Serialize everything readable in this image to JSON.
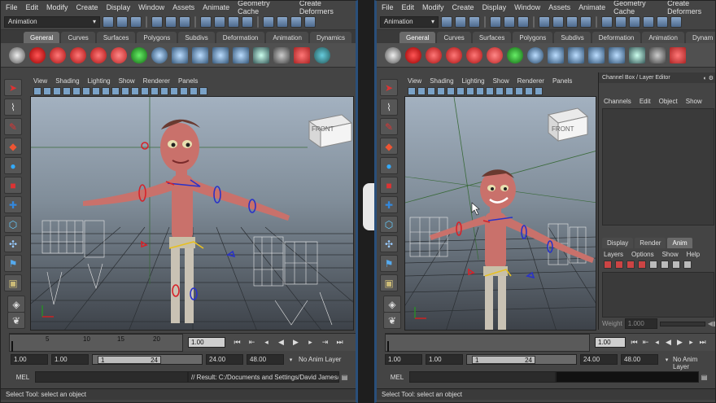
{
  "menus": [
    "File",
    "Edit",
    "Modify",
    "Create",
    "Display",
    "Window",
    "Assets",
    "Animate",
    "Geometry Cache",
    "Create Deformers"
  ],
  "menu_set": "Animation",
  "shelf_tabs": [
    "General",
    "Curves",
    "Surfaces",
    "Polygons",
    "Subdivs",
    "Deformation",
    "Animation",
    "Dynamics"
  ],
  "shelf_tabs_right": [
    "General",
    "Curves",
    "Surfaces",
    "Polygons",
    "Subdivs",
    "Deformation",
    "Animation",
    "Dynam"
  ],
  "active_tab": "General",
  "panel_menus": [
    "View",
    "Shading",
    "Lighting",
    "Show",
    "Renderer",
    "Panels"
  ],
  "viewcube_label": "FRONT",
  "timeline": {
    "ticks": [
      "5",
      "10",
      "15",
      "20"
    ],
    "current_frame": "1.00"
  },
  "range": {
    "start": "1.00",
    "playback_start": "1.00",
    "slider_start": "1",
    "slider_end": "24",
    "playback_end": "24.00",
    "end": "48.00",
    "anim_layer": "No Anim Layer"
  },
  "command": {
    "label": "MEL",
    "result": "// Result: C:/Documents and Settings/David James/My D"
  },
  "help_line": "Select Tool: select an object",
  "channel_box": {
    "title": "Channel Box / Layer Editor",
    "menus": [
      "Channels",
      "Edit",
      "Object",
      "Show"
    ],
    "layer_tabs": [
      "Display",
      "Render",
      "Anim"
    ],
    "active_layer_tab": "Anim",
    "layer_menus": [
      "Layers",
      "Options",
      "Show",
      "Help"
    ],
    "weight_label": "Weight",
    "weight_value": "1.000"
  },
  "colors": {
    "accent_blue": "#2a4f7a",
    "skin": "#c9716b",
    "control_red": "#d6232a",
    "control_blue": "#2a32c8",
    "grid": "#2b2f33"
  }
}
